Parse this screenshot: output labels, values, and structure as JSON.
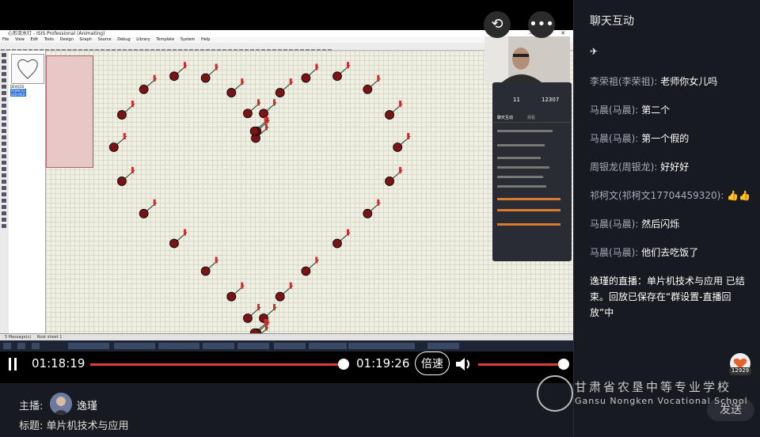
{
  "window": {
    "title": "心形流水灯 - ISIS Professional (Animating)",
    "menus": [
      "File",
      "View",
      "Edit",
      "Tools",
      "Design",
      "Graph",
      "Source",
      "Debug",
      "Library",
      "Template",
      "System",
      "Help"
    ],
    "devices_label": "DEVICES",
    "status_text": "Root sheet 1",
    "messages": "5 Message(s)",
    "anim": "Animating"
  },
  "overlay": {
    "rotate_icon": "rotate-screen-icon",
    "more_icon": "more-icon",
    "more_glyph": "•••",
    "stats": {
      "viewers": "11",
      "likes": "12307"
    },
    "tabs": [
      "聊天互动",
      "观看"
    ]
  },
  "player": {
    "current_time": "01:18:19",
    "total_time": "01:19:26",
    "speed_label": "倍速",
    "progress": 0.985,
    "volume": 0.97
  },
  "footer": {
    "host_label": "主播:",
    "host_name": "逸瑾",
    "title_label": "标题:",
    "title_value": "单片机技术与应用"
  },
  "sidebar": {
    "title": "聊天互动",
    "partial_emoji": "✈",
    "messages": [
      {
        "user": "李荣祖(李荣祖):",
        "text": "老师你女儿吗"
      },
      {
        "user": "马晨(马晨):",
        "text": "第二个"
      },
      {
        "user": "马晨(马晨):",
        "text": "第一个假的"
      },
      {
        "user": "周银龙(周银龙):",
        "text": "好好好"
      },
      {
        "user": "祁柯文(祁柯文17704459320):",
        "text": "👍👍"
      },
      {
        "user": "马晨(马晨):",
        "text": "然后闪烁"
      },
      {
        "user": "马晨(马晨):",
        "text": "他们去吃饭了"
      }
    ],
    "system_message": "逸瑾的直播：单片机技术与应用 已结束。回放已保存在“群设置-直播回放”中",
    "like_count": "12929",
    "send_label": "发送"
  },
  "watermark": {
    "cn": "甘肃省农垦中等专业学校",
    "en": "Gansu Nongken Vocational School"
  },
  "colors": {
    "accent": "#e03b3b",
    "led": "#7a1313"
  }
}
